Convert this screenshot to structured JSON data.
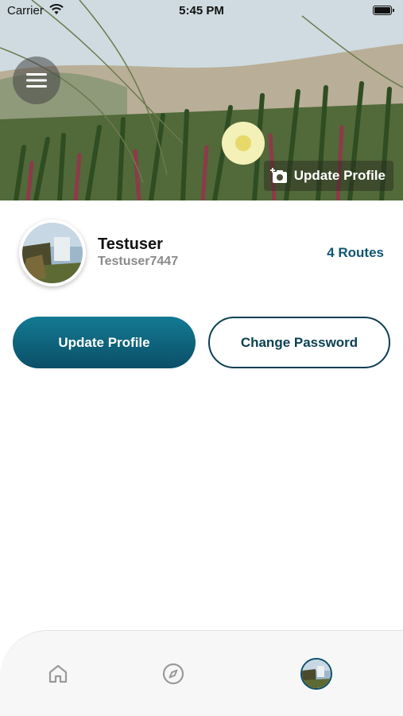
{
  "status_bar": {
    "carrier": "Carrier",
    "time": "5:45 PM"
  },
  "cover": {
    "update_label": "Update Profile"
  },
  "profile": {
    "display_name": "Testuser",
    "username": "Testuser7447",
    "routes_label": "4 Routes"
  },
  "actions": {
    "update_profile_label": "Update Profile",
    "change_password_label": "Change Password"
  },
  "tab_bar": {
    "icons": [
      "home-icon",
      "compass-icon",
      "profile-avatar"
    ],
    "active": "profile"
  },
  "colors": {
    "accent": "#0e5672",
    "primary_button_top": "#137a93",
    "primary_button_bottom": "#0b4f67",
    "outline": "#0b3f52"
  }
}
